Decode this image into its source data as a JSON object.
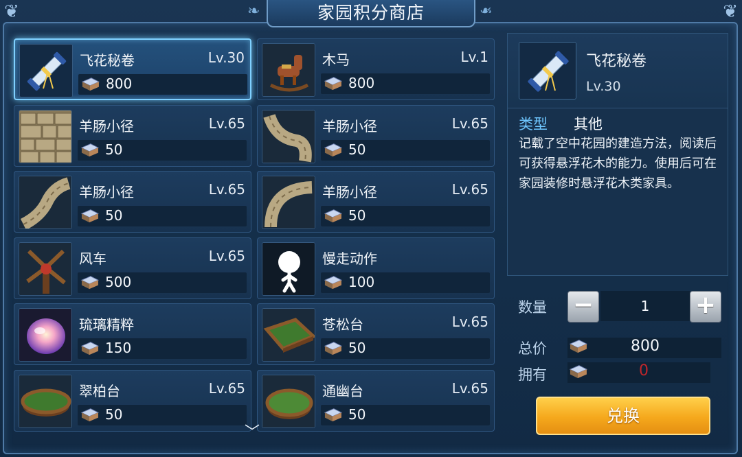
{
  "title": "家园积分商店",
  "items": [
    {
      "name": "飞花秘卷",
      "level": "Lv.30",
      "price": "800",
      "icon": "scroll-icon",
      "selected": true
    },
    {
      "name": "木马",
      "level": "Lv.1",
      "price": "800",
      "icon": "rocking-horse-icon"
    },
    {
      "name": "羊肠小径",
      "level": "Lv.65",
      "price": "50",
      "icon": "stone-path-icon"
    },
    {
      "name": "羊肠小径",
      "level": "Lv.65",
      "price": "50",
      "icon": "curved-path-icon"
    },
    {
      "name": "羊肠小径",
      "level": "Lv.65",
      "price": "50",
      "icon": "diagonal-path-icon"
    },
    {
      "name": "羊肠小径",
      "level": "Lv.65",
      "price": "50",
      "icon": "arc-path-icon"
    },
    {
      "name": "风车",
      "level": "Lv.65",
      "price": "500",
      "icon": "windmill-icon"
    },
    {
      "name": "慢走动作",
      "level": "",
      "price": "100",
      "icon": "walking-figure-icon"
    },
    {
      "name": "琉璃精粹",
      "level": "",
      "price": "150",
      "icon": "crystal-gem-icon"
    },
    {
      "name": "苍松台",
      "level": "Lv.65",
      "price": "50",
      "icon": "square-platform-icon"
    },
    {
      "name": "翠柏台",
      "level": "Lv.65",
      "price": "50",
      "icon": "oval-platform-icon"
    },
    {
      "name": "通幽台",
      "level": "Lv.65",
      "price": "50",
      "icon": "round-platform-icon"
    }
  ],
  "detail": {
    "name": "飞花秘卷",
    "level": "Lv.30",
    "type_label": "类型",
    "type_value": "其他",
    "description": "记载了空中花园的建造方法，阅读后可获得悬浮花木的能力。使用后可在家园装修时悬浮花木类家具。"
  },
  "purchase": {
    "quantity_label": "数量",
    "quantity": "1",
    "total_label": "总价",
    "total": "800",
    "owned_label": "拥有",
    "owned": "0",
    "owned_color": "#c0262b",
    "exchange_label": "兑换"
  },
  "colors": {
    "accent": "#6fc7ff",
    "button": "#f5a81c"
  }
}
